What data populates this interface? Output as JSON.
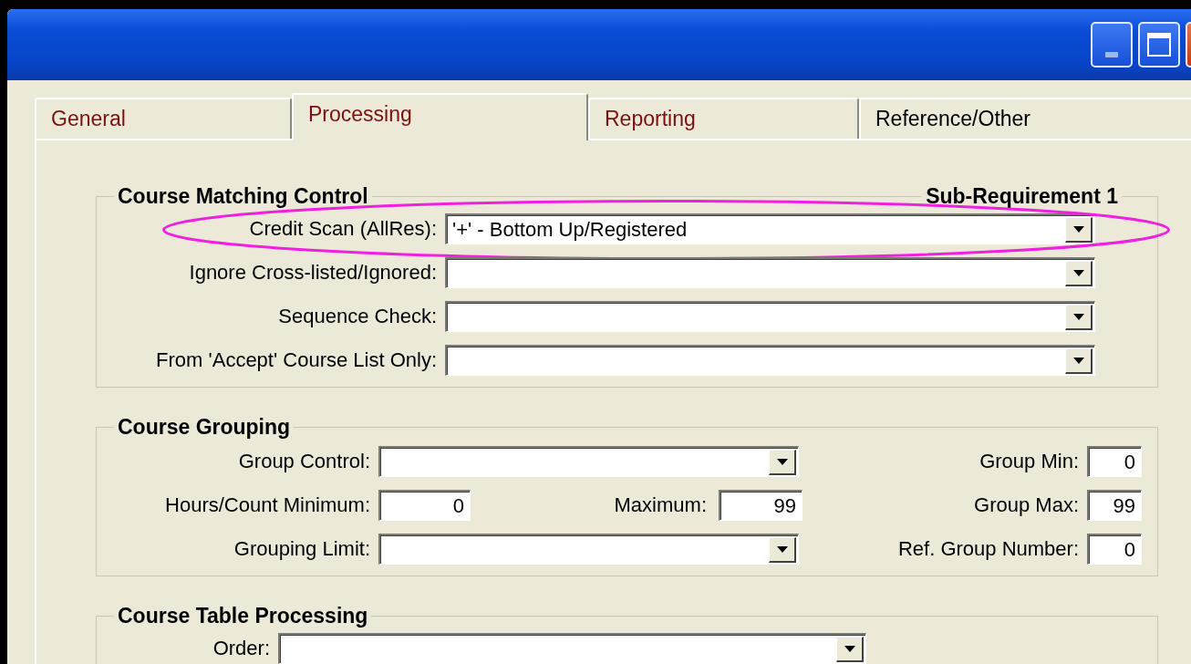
{
  "tabs": [
    {
      "label": "General",
      "selected": false,
      "color": "#7a1010"
    },
    {
      "label": "Processing",
      "selected": true,
      "color": "#7a1010"
    },
    {
      "label": "Reporting",
      "selected": false,
      "color": "#7a1010"
    },
    {
      "label": "Reference/Other",
      "selected": false,
      "color": "#000000"
    }
  ],
  "course_matching_control": {
    "title": "Course Matching Control",
    "subtitle": "Sub-Requirement 1",
    "rows": [
      {
        "label": "Credit Scan (AllRes):",
        "value": "'+' - Bottom Up/Registered",
        "highlighted": true
      },
      {
        "label": "Ignore Cross-listed/Ignored:",
        "highlighted": false
      },
      {
        "label": "Sequence Check:",
        "highlighted": false
      },
      {
        "label": "From 'Accept' Course List Only:",
        "highlighted": false
      }
    ]
  },
  "course_grouping": {
    "title": "Course Grouping",
    "rows": [
      {
        "cells": [
          {
            "kind": "combo",
            "label": "Group Control:"
          },
          {
            "kind": "number",
            "label": "Group Min:",
            "value": "0"
          }
        ]
      },
      {
        "cells": [
          {
            "kind": "number",
            "label": "Hours/Count Minimum:",
            "value": "0"
          },
          {
            "kind": "number",
            "label": "Maximum:",
            "value": "99"
          },
          {
            "kind": "number",
            "label": "Group Max:",
            "value": "99"
          }
        ]
      },
      {
        "cells": [
          {
            "kind": "combo",
            "label": "Grouping Limit:"
          },
          {
            "kind": "number",
            "label": "Ref. Group Number:",
            "value": "0"
          }
        ]
      }
    ]
  },
  "course_table_processing": {
    "title": "Course Table Processing",
    "rows": [
      {
        "label": "Order:"
      }
    ]
  }
}
